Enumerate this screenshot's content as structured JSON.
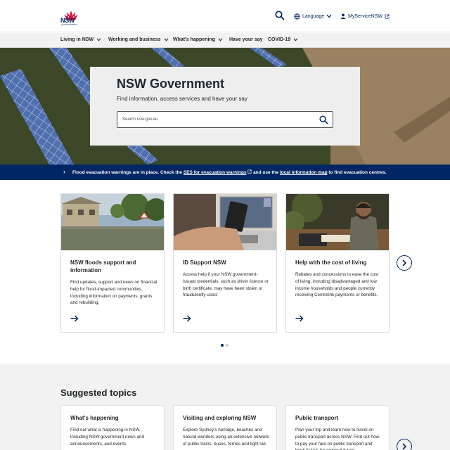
{
  "header": {
    "logo_text": "NSW",
    "logo_sub": "GOVERNMENT",
    "search_icon": "search-icon",
    "language_label": "Language",
    "myservice_label": "MyServiceNSW"
  },
  "nav": {
    "items": [
      {
        "label": "Living in NSW",
        "has_menu": true
      },
      {
        "label": "Working and business",
        "has_menu": true
      },
      {
        "label": "What's happening",
        "has_menu": true
      },
      {
        "label": "Have your say",
        "has_menu": false
      },
      {
        "label": "COVID-19",
        "has_menu": true
      }
    ]
  },
  "hero": {
    "title": "NSW Government",
    "subtitle": "Find information, access services and have your say",
    "search_placeholder": "Search nsw.gov.au"
  },
  "alert": {
    "text_before": "Flood evacuation warnings are in place. Check the",
    "link1": "SES for evacuation warnings",
    "text_middle": "and use the",
    "link2": "local information map",
    "text_after": "to find evacuation centres."
  },
  "cards": [
    {
      "title": "NSW floods support and information",
      "desc": "Find updates, support and news on financial help for flood-impacted communities, including information on payments, grants and rebuilding."
    },
    {
      "title": "ID Support NSW",
      "desc": "Access help if your NSW government-issued credentials, such as driver licence or birth certificate, may have been stolen or fraudulently used."
    },
    {
      "title": "Help with the cost of living",
      "desc": "Rebates and concessions to ease the cost of living, including disadvantaged and low income households and people currently receiving Centrelink payments or benefits."
    }
  ],
  "carousel": {
    "current_page": 1,
    "total_pages": 2
  },
  "topics": {
    "heading": "Suggested topics",
    "items": [
      {
        "title": "What's happening",
        "desc": "Find out what is happening in NSW, including NSW government news and announcements, and events."
      },
      {
        "title": "Visiting and exploring NSW",
        "desc": "Explore Sydney's heritage, beaches and natural wonders using an extensive network of public trains, buses, ferries and light rail."
      },
      {
        "title": "Public transport",
        "desc": "Plan your trip and learn how to travel on public transport across NSW. Find out how to pay your fare on public transport and book tickets for regional travel."
      }
    ]
  },
  "colors": {
    "brand_navy": "#002664",
    "brand_red": "#d7153a",
    "panel_grey": "#f2f2f2"
  }
}
